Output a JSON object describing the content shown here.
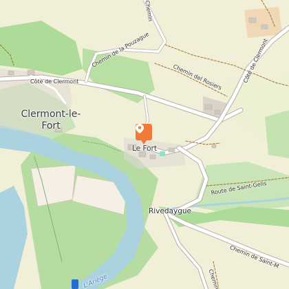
{
  "map": {
    "places": {
      "clermont_le_fort": "Clermont-le-Fort",
      "le_fort": "Le Fort",
      "rivedaygue": "Rivedaygue"
    },
    "roads": {
      "chemin_m": "Chemin",
      "chemin_pouzague": "Chemin de la Pouzague",
      "cote_clermont_left": "Côte de Clermont",
      "cote_clermont_right": "Côte de Clermont",
      "chemin_rosiers": "Chemin del Rosiers",
      "route_saint_gelis": "Route de Saint-Gelis",
      "chemin_saint_m": "Chemin de Saint-M",
      "chemin_bottom": "Chemin"
    },
    "water": {
      "ariege": "L'Ariège"
    },
    "colors": {
      "land": "#f2efd9",
      "forest": "#addb98",
      "river": "#aad3df",
      "marker": "#f07a3a"
    },
    "marker_icon": "map-pin-icon"
  }
}
